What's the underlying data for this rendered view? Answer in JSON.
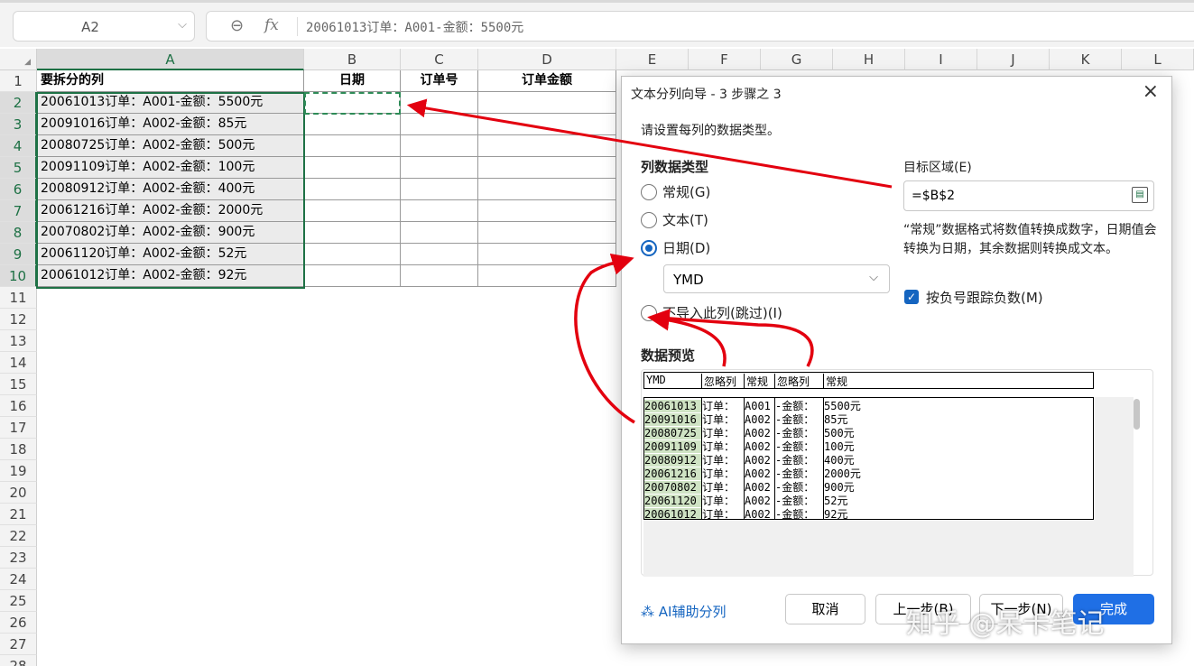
{
  "formula_bar": {
    "name_box": "A2",
    "zoom_icon": "zoom-icon",
    "fx_label": "fx",
    "formula": "20061013订单：A001-金额：5500元"
  },
  "columns": [
    "A",
    "B",
    "C",
    "D",
    "E",
    "F",
    "G",
    "H",
    "I",
    "J",
    "K",
    "L"
  ],
  "rows": [
    "1",
    "2",
    "3",
    "4",
    "5",
    "6",
    "7",
    "8",
    "9",
    "10",
    "11",
    "12",
    "13",
    "14",
    "15",
    "16",
    "17",
    "18",
    "19",
    "20",
    "21",
    "22",
    "23",
    "24",
    "25",
    "26",
    "27",
    "28"
  ],
  "headers": {
    "a": "要拆分的列",
    "b": "日期",
    "c": "订单号",
    "d": "订单金额"
  },
  "data_rows": [
    "20061013订单：A001-金额：5500元",
    "20091016订单：A002-金额：85元",
    "20080725订单：A002-金额：500元",
    "20091109订单：A002-金额：100元",
    "20080912订单：A002-金额：400元",
    "20061216订单：A002-金额：2000元",
    "20070802订单：A002-金额：900元",
    "20061120订单：A002-金额：52元",
    "20061012订单：A002-金额：92元"
  ],
  "dialog": {
    "title": "文本分列向导 - 3 步骤之 3",
    "prompt": "请设置每列的数据类型。",
    "column_type_label": "列数据类型",
    "options": {
      "general": "常规(G)",
      "text": "文本(T)",
      "date": "日期(D)",
      "skip": "不导入此列(跳过)(I)"
    },
    "selected_option": "date",
    "date_format": "YMD",
    "target_label": "目标区域(E)",
    "target_value": "=$B$2",
    "description": "“常规”数据格式将数值转换成数字，日期值会转换为日期，其余数据则转换成文本。",
    "negative_label": "按负号跟踪负数(M)",
    "negative_checked": true,
    "preview_label": "数据预览",
    "preview_headers": [
      "YMD",
      "忽略列",
      "常规",
      "忽略列",
      "常规"
    ],
    "preview_rows": [
      [
        "20061013",
        "订单：",
        "A001",
        "-金额：",
        "5500元"
      ],
      [
        "20091016",
        "订单：",
        "A002",
        "-金额：",
        "85元"
      ],
      [
        "20080725",
        "订单：",
        "A002",
        "-金额：",
        "500元"
      ],
      [
        "20091109",
        "订单：",
        "A002",
        "-金额：",
        "100元"
      ],
      [
        "20080912",
        "订单：",
        "A002",
        "-金额：",
        "400元"
      ],
      [
        "20061216",
        "订单：",
        "A002",
        "-金额：",
        "2000元"
      ],
      [
        "20070802",
        "订单：",
        "A002",
        "-金额：",
        "900元"
      ],
      [
        "20061120",
        "订单：",
        "A002",
        "-金额：",
        "52元"
      ],
      [
        "20061012",
        "订单：",
        "A002",
        "-金额：",
        "92元"
      ]
    ],
    "ai_button": "AI辅助分列",
    "cancel": "取消",
    "back": "上一步(B)",
    "next": "下一步(N)",
    "finish": "完成"
  },
  "watermark": "知乎 @呆卡笔记",
  "colors": {
    "accent_green": "#1e7145",
    "dialog_blue": "#1565c0",
    "annotation_red": "#e3000f"
  }
}
